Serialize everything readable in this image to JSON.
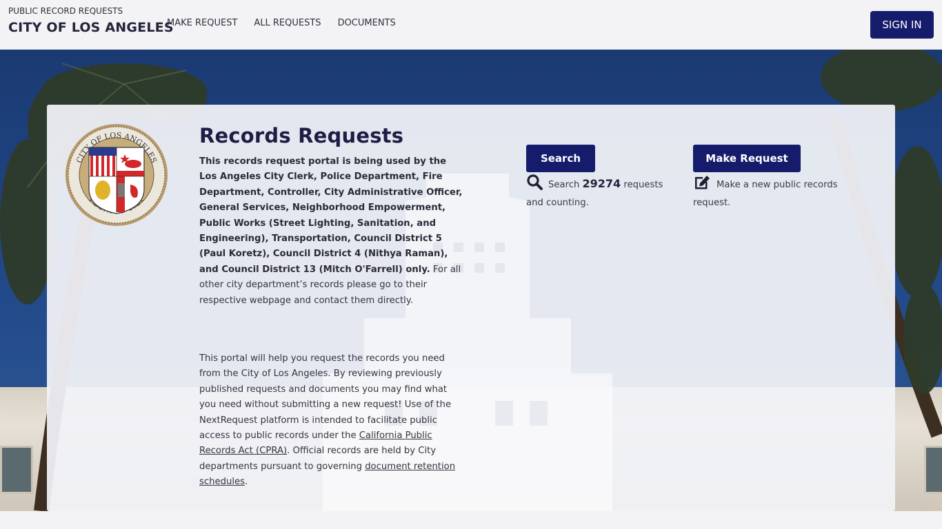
{
  "header": {
    "subtitle": "PUBLIC RECORD REQUESTS",
    "title": "CITY OF LOS ANGELES",
    "nav": [
      {
        "label": "MAKE REQUEST"
      },
      {
        "label": "ALL REQUESTS"
      },
      {
        "label": "DOCUMENTS"
      }
    ],
    "sign_in_label": "SIGN IN"
  },
  "seal": {
    "top_text": "CITY OF LOS ANGELES",
    "bottom_text": "FOUNDED 1781",
    "alt": "City of Los Angeles seal"
  },
  "main": {
    "title": "Records Requests",
    "intro_bold": "This records request portal is being used by the Los Angeles City Clerk, Police Department, Fire Department, Controller, City Administrative Officer, General Services, Neighborhood Empowerment, Public Works (Street Lighting, Sanitation, and Engineering), Transportation, Council District 5 (Paul Koretz), Council District 4 (Nithya Raman), and Council District 13 (Mitch O'Farrell) only.",
    "intro_rest": " For all other city department’s records please go to their respective webpage and contact them directly.",
    "about_part1": "This portal will help you request the records you need from the City of Los Angeles. By reviewing previously published requests and documents you may find what you need without submitting a new request! Use of the NextRequest platform is intended to facilitate public access to public records under the ",
    "about_link1": "California Public Records Act (CPRA)",
    "about_part2": ". Official records are held by City departments pursuant to governing ",
    "about_link2": "document retention schedules",
    "about_part3": "."
  },
  "actions": {
    "search": {
      "button_label": "Search",
      "icon": "search-icon",
      "desc_prefix": "Search ",
      "count": "29274",
      "desc_suffix": " requests and counting."
    },
    "make_request": {
      "button_label": "Make Request",
      "icon": "edit-icon",
      "desc": "Make a new public records request."
    }
  },
  "colors": {
    "primary": "#141c6b",
    "header_bg": "#f3f3f6",
    "title_text": "#1d1d45"
  }
}
